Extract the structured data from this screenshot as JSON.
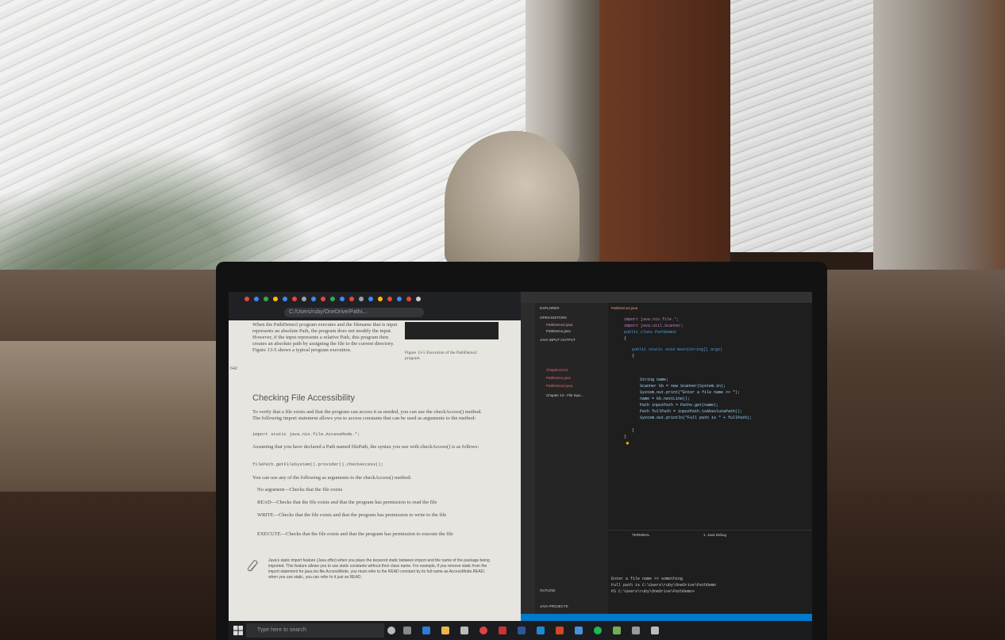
{
  "scene": {
    "description_hint": "",
    "colors": {
      "snow": "#e6e6e4",
      "frame": "#cfcac3",
      "curtain": "#5a2f1d",
      "wall": "#3b2a20"
    }
  },
  "browser": {
    "url": "C:/Users/ruby/OneDrive/Pathi..."
  },
  "document": {
    "paragraph1": "When the PathDemo2 program executes and the filename that is input represents an absolute Path, the program does not modify the input. However, if the input represents a relative Path, this program then creates an absolute path by assigning the file to the current directory. Figure 13-5 shows a typical program execution.",
    "figure_caption": "Figure 13-5 Execution of the PathDemo2 program",
    "page_number": "642",
    "heading": "Checking File Accessibility",
    "paragraph2": "To verify that a file exists and that the program can access it as needed, you can use the checkAccess() method. The following import statement allows you to access constants that can be used as arguments to the method:",
    "code1": "import static java.nio.file.AccessMode.*;",
    "paragraph3": "Assuming that you have declared a Path named filePath, the syntax you use with checkAccess() is as follows:",
    "code2": "filePath.getFileSystem().provider().checkAccess();",
    "paragraph4": "You can use any of the following as arguments to the checkAccess() method:",
    "bullets": [
      "No argument—Checks that the file exists",
      "READ—Checks that the file exists and that the program has permission to read the file",
      "WRITE—Checks that the file exists and that the program has permission to write to the file",
      "EXECUTE—Checks that the file exists and that the program has permission to execute the file"
    ],
    "note": "Java's static import feature (Java offer) when you place the keyword static between import and the name of the package being imported. This feature allows you to use static constants without their class name. For example, if you remove static from the import statement for java.nio.file.AccessMode, you must refer to the READ constant by its full name as AccessMode.READ; when you use static, you can refer to it just as READ."
  },
  "vscode": {
    "sidebar_title": "EXPLORER",
    "sidebar_sections": [
      "OPEN EDITORS",
      "JAVA INPUT OUTPUT",
      "OUTLINE",
      "JAVA PROJECTS"
    ],
    "files": [
      "PathDemo2.java",
      "PathDemo.java",
      "Chapter13.txt",
      "PathDemo.java",
      "PathDemo2.java",
      "Chapter 13 - File Inpu..."
    ],
    "tab": "PathDemo2.java",
    "code_lines": [
      "import java.nio.file.*;",
      "import java.util.Scanner;",
      "public class PathDemo2",
      "{",
      "   public static void main(String[] args)",
      "   {",
      "      String name;",
      "      Scanner kb = new Scanner(System.in);",
      "      System.out.print(\"Enter a file name >> \");",
      "      name = kb.nextLine();",
      "      Path inputPath = Paths.get(name);",
      "      Path fullPath = inputPath.toAbsolutePath();",
      "      System.out.println(\"Full path is \" + fullPath);",
      "   }",
      "}"
    ],
    "terminal_tab": "TERMINAL",
    "terminal_dropdown": "1: Java Debug",
    "terminal_lines": [
      "Enter a file name >> something",
      "Full path is C:\\Users\\ruby\\OneDrive\\PathDemo",
      "PS C:\\Users\\ruby\\OneDrive\\PathDemo>"
    ]
  },
  "taskbar": {
    "search_placeholder": "Type here to search"
  }
}
